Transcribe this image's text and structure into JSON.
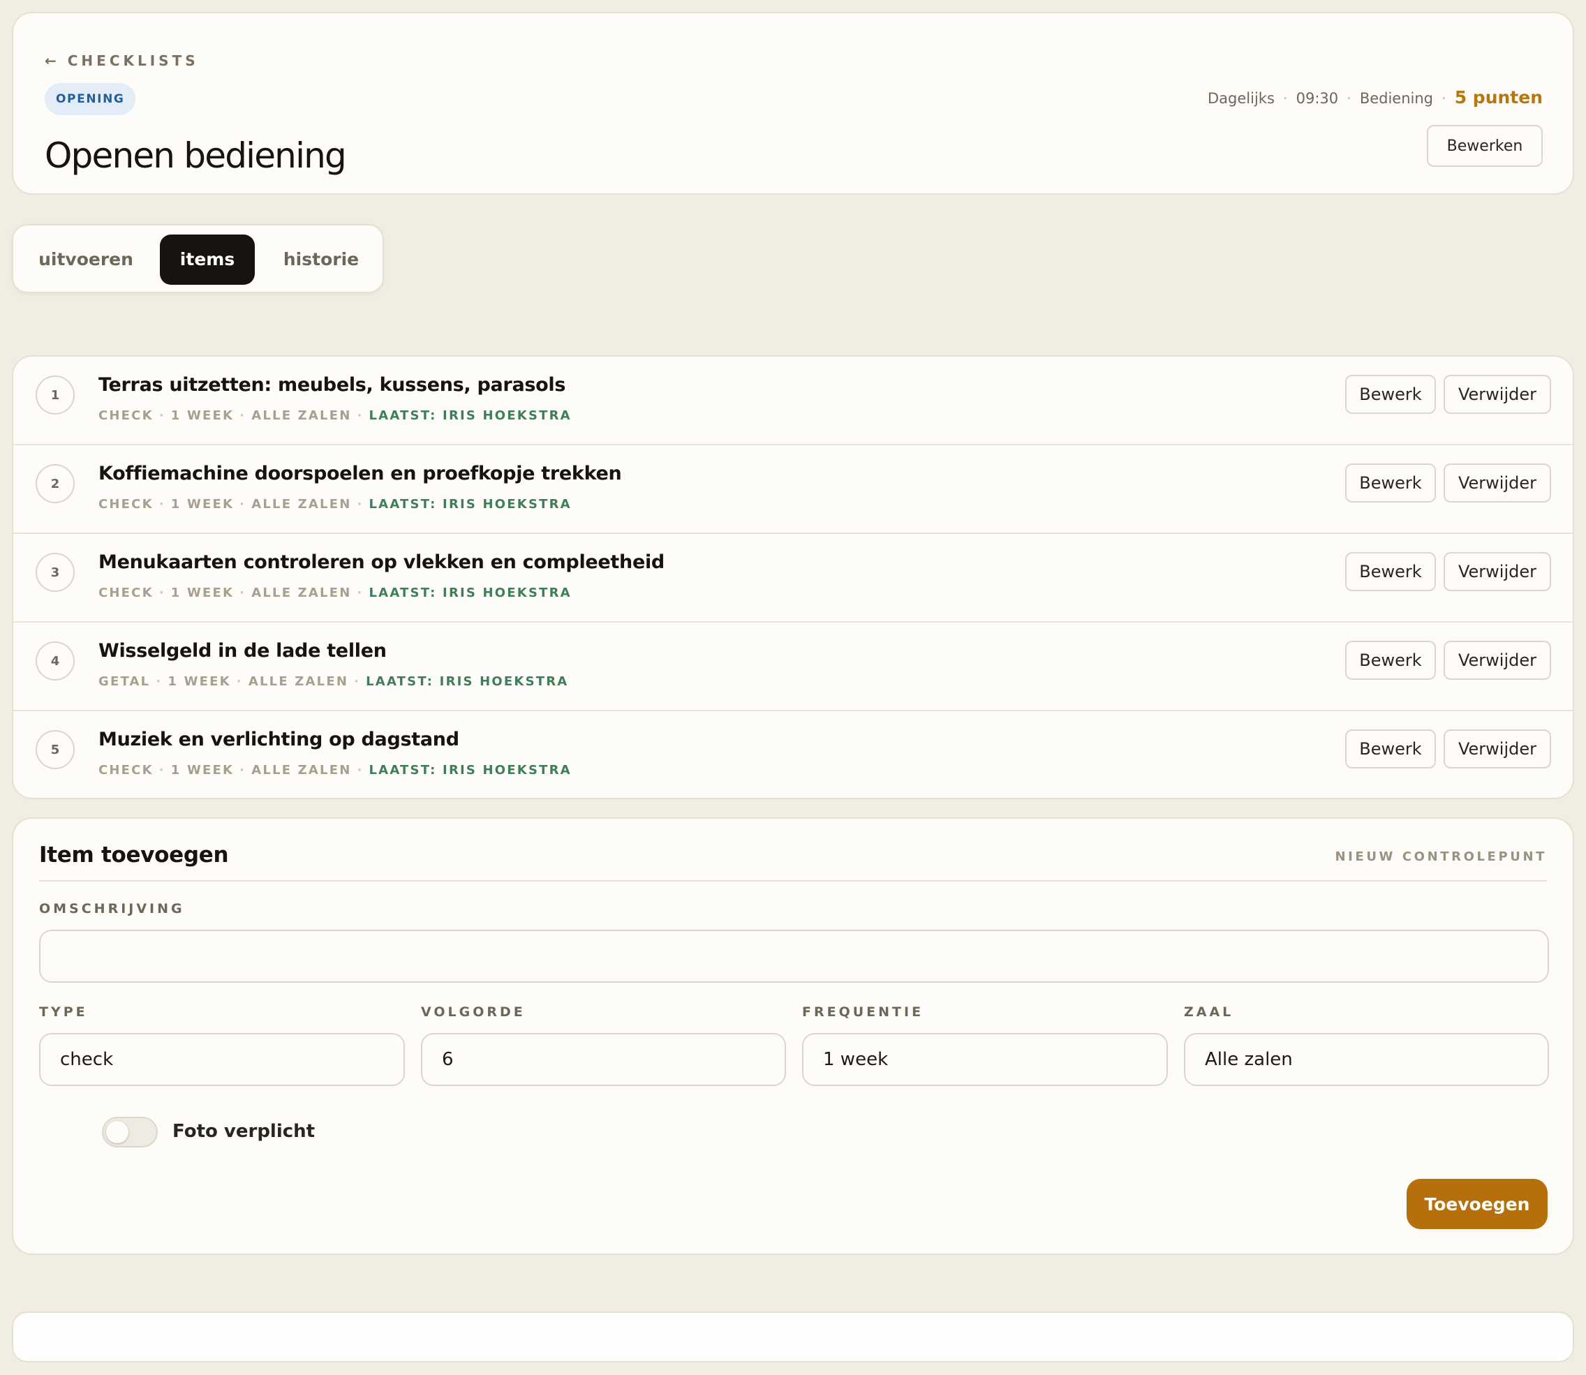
{
  "header": {
    "back_label": "CHECKLISTS",
    "back_arrow": "←",
    "badge": "OPENING",
    "title": "Openen bediening",
    "meta": {
      "frequency": "Dagelijks",
      "time": "09:30",
      "department": "Bediening",
      "points": "5 punten"
    },
    "edit_label": "Bewerken"
  },
  "tabs": [
    {
      "label": "uitvoeren",
      "active": false
    },
    {
      "label": "items",
      "active": true
    },
    {
      "label": "historie",
      "active": false
    }
  ],
  "items": [
    {
      "num": "1",
      "title": "Terras uitzetten: meubels, kussens, parasols",
      "type": "CHECK",
      "frequency": "1 WEEK",
      "zone": "ALLE ZALEN",
      "last": "LAATST: IRIS HOEKSTRA"
    },
    {
      "num": "2",
      "title": "Koffiemachine doorspoelen en proefkopje trekken",
      "type": "CHECK",
      "frequency": "1 WEEK",
      "zone": "ALLE ZALEN",
      "last": "LAATST: IRIS HOEKSTRA"
    },
    {
      "num": "3",
      "title": "Menukaarten controleren op vlekken en compleetheid",
      "type": "CHECK",
      "frequency": "1 WEEK",
      "zone": "ALLE ZALEN",
      "last": "LAATST: IRIS HOEKSTRA"
    },
    {
      "num": "4",
      "title": "Wisselgeld in de lade tellen",
      "type": "GETAL",
      "frequency": "1 WEEK",
      "zone": "ALLE ZALEN",
      "last": "LAATST: IRIS HOEKSTRA"
    },
    {
      "num": "5",
      "title": "Muziek en verlichting op dagstand",
      "type": "CHECK",
      "frequency": "1 WEEK",
      "zone": "ALLE ZALEN",
      "last": "LAATST: IRIS HOEKSTRA"
    }
  ],
  "item_actions": {
    "edit_label": "Bewerk",
    "delete_label": "Verwijder"
  },
  "form": {
    "title": "Item toevoegen",
    "subtitle": "NIEUW CONTROLEPUNT",
    "description_label": "OMSCHRIJVING",
    "description_value": "",
    "type_label": "TYPE",
    "type_value": "check",
    "order_label": "VOLGORDE",
    "order_value": "6",
    "frequency_label": "FREQUENTIE",
    "frequency_value": "1 week",
    "zone_label": "ZAAL",
    "zone_value": "Alle zalen",
    "photo_label": "Foto verplicht",
    "photo_required": false,
    "submit_label": "Toevoegen"
  },
  "colors": {
    "background": "#f1ede3",
    "card": "#fdfcf8",
    "accent": "#b5700c",
    "badge_bg": "#e2edf7",
    "badge_text": "#23609a",
    "last_done": "#3f7e59",
    "active_tab": "#17140f"
  }
}
